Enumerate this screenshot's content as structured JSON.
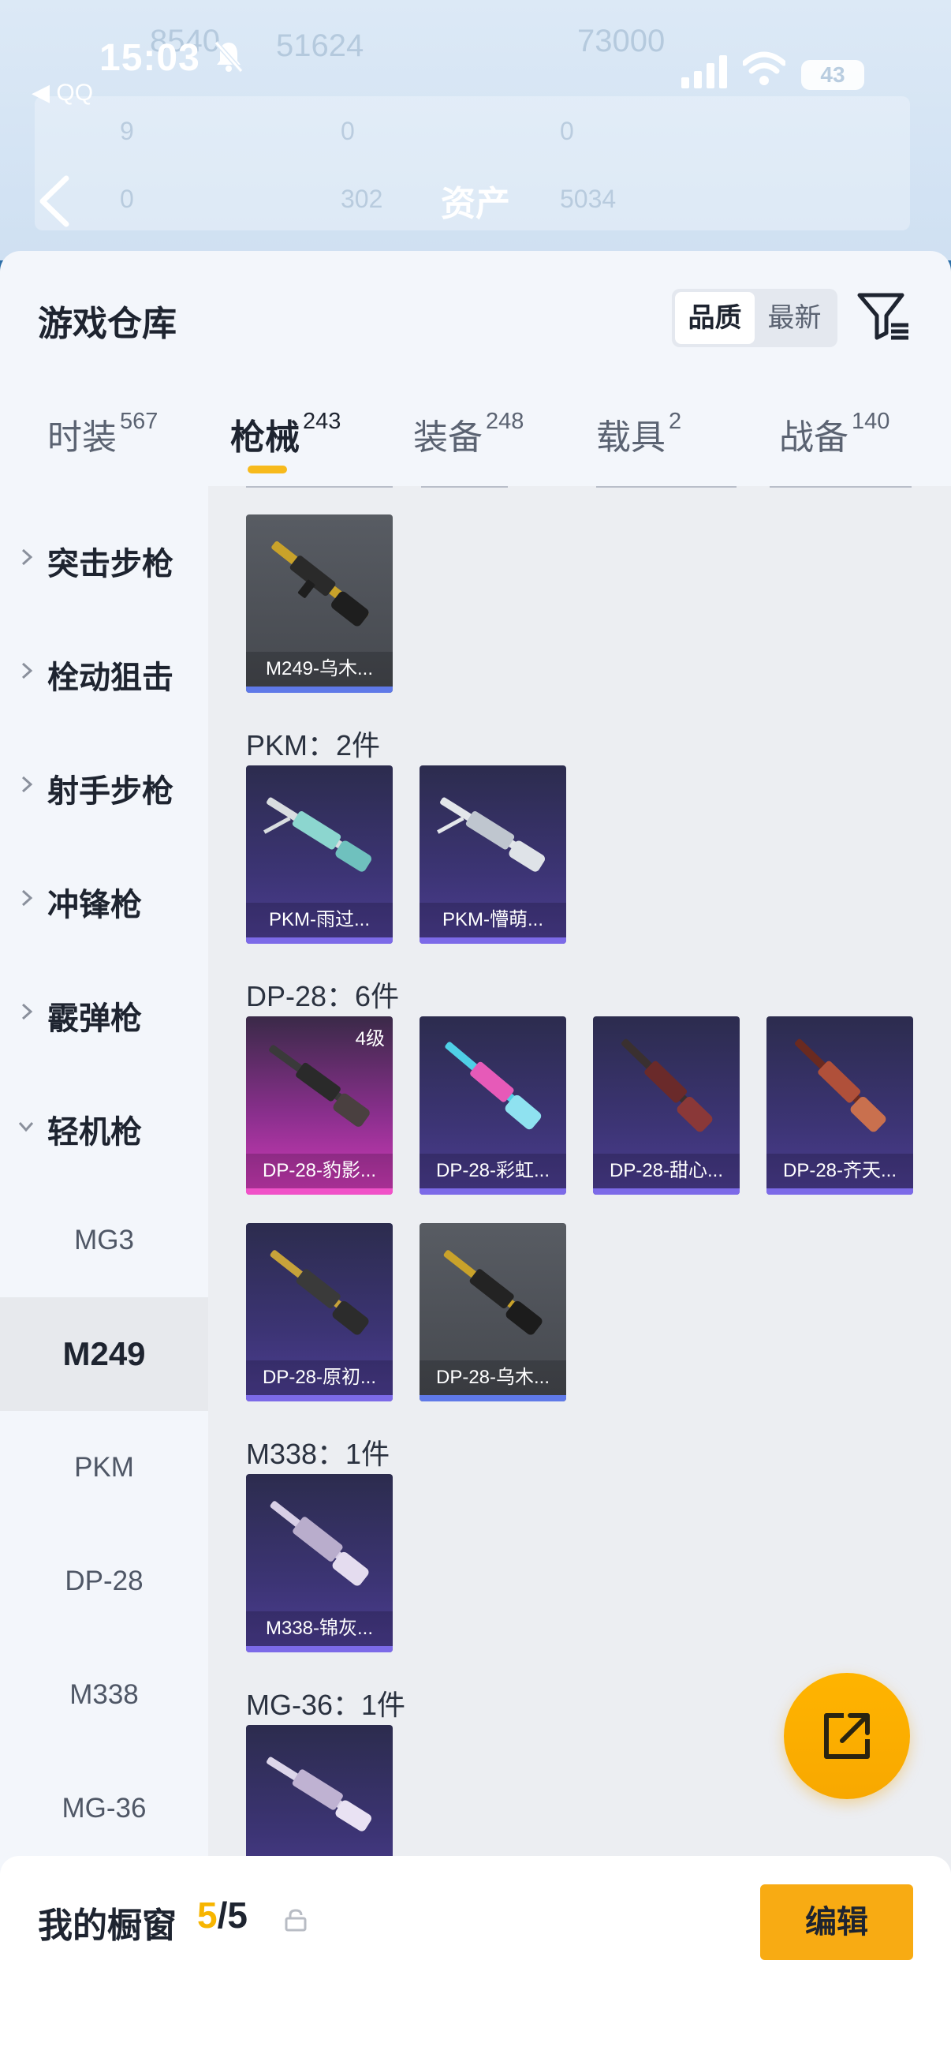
{
  "status_bar": {
    "time": "15:03",
    "back_app": "◀ QQ",
    "battery": "43"
  },
  "header": {
    "title": "资产",
    "background_values": [
      "8540",
      "51624",
      "73000",
      "9",
      "0",
      "0",
      "0",
      "302",
      "5034"
    ]
  },
  "sheet": {
    "title": "游戏仓库",
    "sort_options": [
      {
        "label": "品质",
        "active": true
      },
      {
        "label": "最新",
        "active": false
      }
    ]
  },
  "tabs": [
    {
      "label": "时装",
      "count": "567",
      "active": false
    },
    {
      "label": "枪械",
      "count": "243",
      "active": true
    },
    {
      "label": "装备",
      "count": "248",
      "active": false
    },
    {
      "label": "载具",
      "count": "2",
      "active": false
    },
    {
      "label": "战备",
      "count": "140",
      "active": false
    }
  ],
  "sidebar": {
    "categories": [
      {
        "label": "突击步枪",
        "expanded": false
      },
      {
        "label": "栓动狙击",
        "expanded": false
      },
      {
        "label": "射手步枪",
        "expanded": false
      },
      {
        "label": "冲锋枪",
        "expanded": false
      },
      {
        "label": "霰弹枪",
        "expanded": false
      },
      {
        "label": "轻机枪",
        "expanded": true
      }
    ],
    "subitems": [
      {
        "label": "MG3",
        "active": false
      },
      {
        "label": "M249",
        "active": true
      },
      {
        "label": "PKM",
        "active": false
      },
      {
        "label": "DP-28",
        "active": false
      },
      {
        "label": "M338",
        "active": false
      },
      {
        "label": "MG-36",
        "active": false
      }
    ]
  },
  "groups": [
    {
      "title": "",
      "items": [
        {
          "name": "M249-乌木...",
          "rarity": "grey"
        }
      ]
    },
    {
      "title": "PKM：2件",
      "items": [
        {
          "name": "PKM-雨过...",
          "rarity": "purple"
        },
        {
          "name": "PKM-懵萌...",
          "rarity": "purple"
        }
      ]
    },
    {
      "title": "DP-28：6件",
      "items": [
        {
          "name": "DP-28-豹影...",
          "rarity": "pink",
          "level": "4级"
        },
        {
          "name": "DP-28-彩虹...",
          "rarity": "purple"
        },
        {
          "name": "DP-28-甜心...",
          "rarity": "purple"
        },
        {
          "name": "DP-28-齐天...",
          "rarity": "purple"
        },
        {
          "name": "DP-28-原初...",
          "rarity": "purple"
        },
        {
          "name": "DP-28-乌木...",
          "rarity": "grey"
        }
      ]
    },
    {
      "title": "M338：1件",
      "items": [
        {
          "name": "M338-锦灰...",
          "rarity": "purple"
        }
      ]
    },
    {
      "title": "MG-36：1件",
      "items": [
        {
          "name": "",
          "rarity": "purple"
        }
      ]
    }
  ],
  "showcase": {
    "title": "我的橱窗",
    "current": "5",
    "total": "/5",
    "edit_label": "编辑"
  },
  "colors": {
    "accent": "#f7ba1c",
    "edit_button": "#f8ab13",
    "purple_tier": "#7c6ae8",
    "pink_tier": "#f052c8",
    "grey_tier": "#5f79e8"
  },
  "icons": [
    "bell-muted-icon",
    "signal-icon",
    "wifi-icon",
    "back-arrow-icon",
    "filter-icon",
    "chevron-right-icon",
    "chevron-down-icon",
    "share-icon",
    "lock-icon",
    "gun-icon"
  ]
}
